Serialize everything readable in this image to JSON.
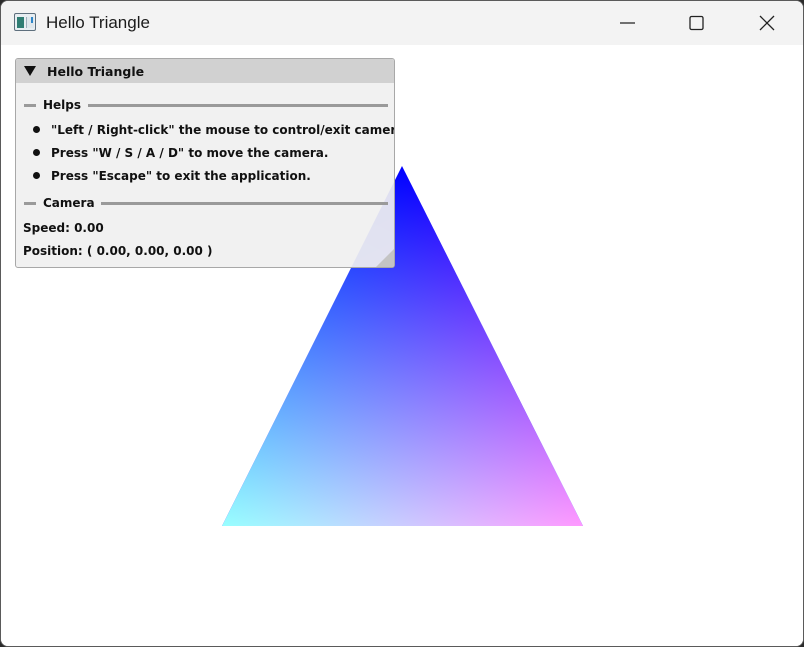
{
  "window": {
    "title": "Hello Triangle",
    "icon": "app-icon",
    "controls": [
      "minimize-icon",
      "maximize-icon",
      "close-icon"
    ]
  },
  "panel": {
    "title": "Hello Triangle",
    "collapse_icon": "triangle-down-icon",
    "helps": {
      "label": "Helps",
      "items": [
        "\"Left / Right-click\" the mouse to control/exit camera.",
        "Press \"W / S / A / D\" to move the camera.",
        "Press \"Escape\" to exit the application."
      ]
    },
    "camera": {
      "label": "Camera",
      "speed": "Speed: 0.00",
      "position": "Position: ( 0.00, 0.00, 0.00 )"
    }
  },
  "scene": {
    "vertex_colors": {
      "top": "#0000ff",
      "left": "#00ff00",
      "right": "#ff0000"
    }
  }
}
